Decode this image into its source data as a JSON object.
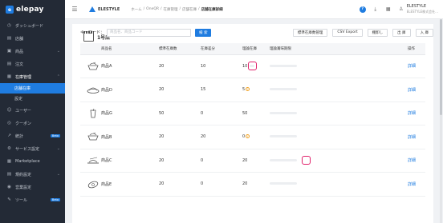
{
  "brand": {
    "logo_text": "elepay",
    "logo_mark": "e"
  },
  "sidebar": {
    "items": [
      {
        "icon": "dashboard-icon",
        "glyph": "◷",
        "label": "ダッシュボード",
        "chev": ""
      },
      {
        "icon": "store-icon",
        "glyph": "▤",
        "label": "店舗",
        "chev": ""
      },
      {
        "icon": "product-icon",
        "glyph": "▣",
        "label": "商品",
        "chev": "⌄"
      },
      {
        "icon": "order-icon",
        "glyph": "▤",
        "label": "注文",
        "chev": ""
      },
      {
        "icon": "inventory-icon",
        "glyph": "▦",
        "label": "在庫管理",
        "chev": "⌃"
      }
    ],
    "sub_items": [
      {
        "label": "店舗在庫",
        "active": true
      },
      {
        "label": "設定",
        "active": false
      }
    ],
    "items2": [
      {
        "icon": "user-icon",
        "glyph": "☺",
        "label": "ユーザー",
        "chev": "",
        "badge": ""
      },
      {
        "icon": "coupon-icon",
        "glyph": "◎",
        "label": "クーポン",
        "chev": "",
        "badge": ""
      },
      {
        "icon": "stats-icon",
        "glyph": "↗",
        "label": "統計",
        "chev": "",
        "badge": "Beta"
      },
      {
        "icon": "service-settings-icon",
        "glyph": "⚙",
        "label": "サービス設定",
        "chev": "⌄",
        "badge": ""
      },
      {
        "icon": "marketplace-icon",
        "glyph": "▦",
        "label": "Marketplace",
        "chev": "",
        "badge": ""
      },
      {
        "icon": "contract-icon",
        "glyph": "▤",
        "label": "規約設定",
        "chev": "⌄",
        "badge": ""
      },
      {
        "icon": "business-settings-icon",
        "glyph": "◉",
        "label": "営業設定",
        "chev": "",
        "badge": ""
      },
      {
        "icon": "tools-icon",
        "glyph": "✎",
        "label": "ツール",
        "chev": "",
        "badge": "Beta"
      }
    ]
  },
  "topbar": {
    "brand_name": "ELESTYLE",
    "breadcrumbs": [
      "ホーム",
      "OneQR",
      "在庫管理",
      "店舗在庫"
    ],
    "current": "店舗在庫詳細",
    "user_name": "ELESTYLE",
    "company": "ELESTYLE株式会社..."
  },
  "panel": {
    "title": "1号店",
    "keyword_label": "キーワード：",
    "keyword_placeholder": "商品名、商品コード",
    "search_label": "検 索",
    "actions": [
      "標準在庫数管理",
      "CSV Export",
      "棚卸し",
      "出 庫",
      "入 庫"
    ]
  },
  "table": {
    "headers": [
      "商品名",
      "標準在庫数",
      "在庫差分",
      "理論在庫",
      "理論賞味期限",
      "操作"
    ],
    "rows": [
      {
        "thumb": "noodle-bowl",
        "name": "商品A",
        "std": "20",
        "gap": "10",
        "theo": "10",
        "warn": false,
        "highlight_theo": true,
        "highlight_period": false,
        "op": "詳細"
      },
      {
        "thumb": "dish",
        "name": "商品D",
        "std": "20",
        "gap": "15",
        "theo": "5",
        "warn": true,
        "highlight_theo": false,
        "highlight_period": false,
        "op": "詳細"
      },
      {
        "thumb": "drink-cup",
        "name": "商品G",
        "std": "50",
        "gap": "0",
        "theo": "50",
        "warn": false,
        "highlight_theo": false,
        "highlight_period": false,
        "op": "詳細"
      },
      {
        "thumb": "noodle-bowl",
        "name": "商品B",
        "std": "20",
        "gap": "20",
        "theo": "0",
        "warn": true,
        "highlight_theo": false,
        "highlight_period": false,
        "op": "詳細"
      },
      {
        "thumb": "noodle-plate",
        "name": "商品C",
        "std": "20",
        "gap": "0",
        "theo": "20",
        "warn": false,
        "highlight_theo": false,
        "highlight_period": true,
        "op": "詳細"
      },
      {
        "thumb": "sushi-roll",
        "name": "商品E",
        "std": "20",
        "gap": "0",
        "theo": "20",
        "warn": false,
        "highlight_theo": false,
        "highlight_period": false,
        "op": "詳細"
      }
    ]
  },
  "colors": {
    "primary": "#1f7ce0",
    "sidebar": "#232a36",
    "highlight": "#e0206a",
    "warning": "#f0a020"
  }
}
